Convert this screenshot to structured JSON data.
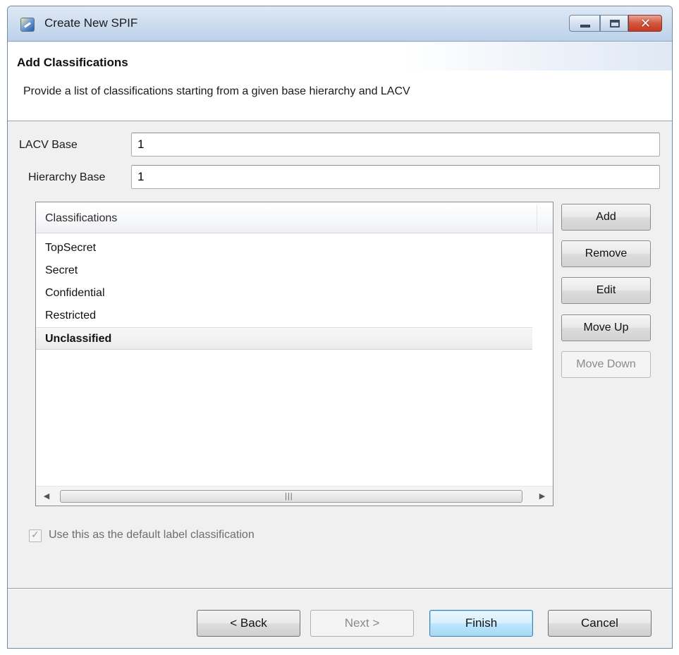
{
  "window": {
    "title": "Create New SPIF",
    "controls": {
      "minimize": "minimize",
      "maximize": "maximize",
      "close": "close"
    }
  },
  "header": {
    "title": "Add Classifications",
    "description": "Provide a list of classifications starting from a given base hierarchy and LACV"
  },
  "form": {
    "lacv_base": {
      "label": "LACV Base",
      "value": "1"
    },
    "hierarchy_base": {
      "label": "Hierarchy Base",
      "value": "1"
    }
  },
  "classifications": {
    "column_header": "Classifications",
    "items": [
      "TopSecret",
      "Secret",
      "Confidential",
      "Restricted",
      "Unclassified"
    ],
    "selected": "Unclassified"
  },
  "side_buttons": {
    "add": "Add",
    "remove": "Remove",
    "edit": "Edit",
    "move_up": "Move Up",
    "move_down": "Move Down"
  },
  "checkbox": {
    "label": "Use this as the default label classification",
    "checked": true,
    "enabled": false
  },
  "footer": {
    "back": "< Back",
    "next": "Next >",
    "finish": "Finish",
    "cancel": "Cancel"
  },
  "icons": {
    "app": "spif-app-icon",
    "scroll_left": "chevron-left-icon",
    "scroll_right": "chevron-right-icon",
    "check": "checkmark-icon"
  },
  "colors": {
    "titlebar": "#cfdeef",
    "close_button": "#c23b22",
    "default_button": "#bee6fd"
  }
}
